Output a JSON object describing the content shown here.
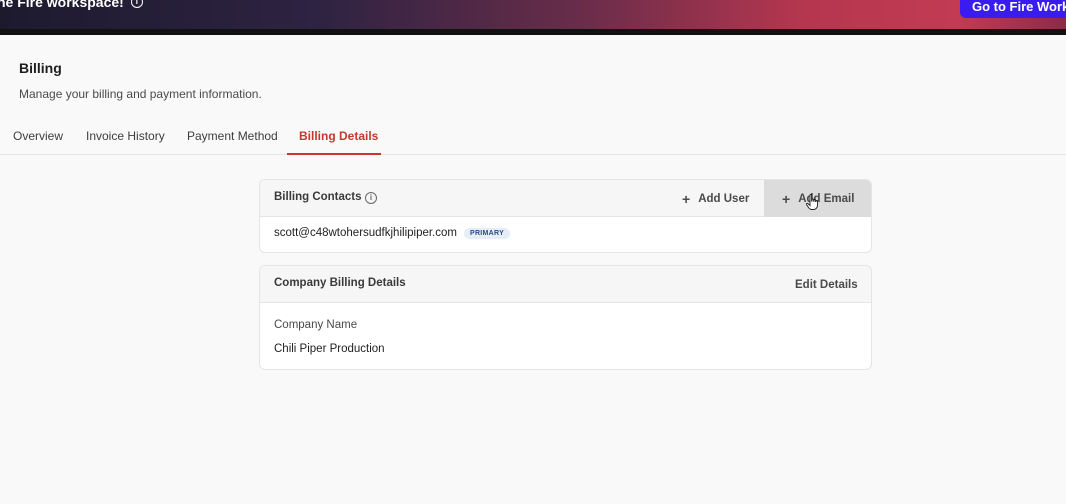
{
  "banner": {
    "text": "he Fire workspace!",
    "button_label": "Go to Fire Workspa"
  },
  "page": {
    "title": "Billing",
    "subtitle": "Manage your billing and payment information."
  },
  "tabs": [
    {
      "label": "Overview",
      "active": false
    },
    {
      "label": "Invoice History",
      "active": false
    },
    {
      "label": "Payment Method",
      "active": false
    },
    {
      "label": "Billing Details",
      "active": true
    }
  ],
  "billing_contacts": {
    "title": "Billing Contacts",
    "add_user_label": "Add User",
    "add_email_label": "Add Email",
    "contacts": [
      {
        "email": "scott@c48wtohersudfkjhilipiper.com",
        "badge": "PRIMARY"
      }
    ]
  },
  "company_details": {
    "title": "Company Billing Details",
    "edit_label": "Edit Details",
    "fields": [
      {
        "label": "Company Name",
        "value": "Chili Piper Production"
      }
    ]
  },
  "colors": {
    "accent": "#c7372f",
    "banner_button": "#3b1cf0"
  }
}
